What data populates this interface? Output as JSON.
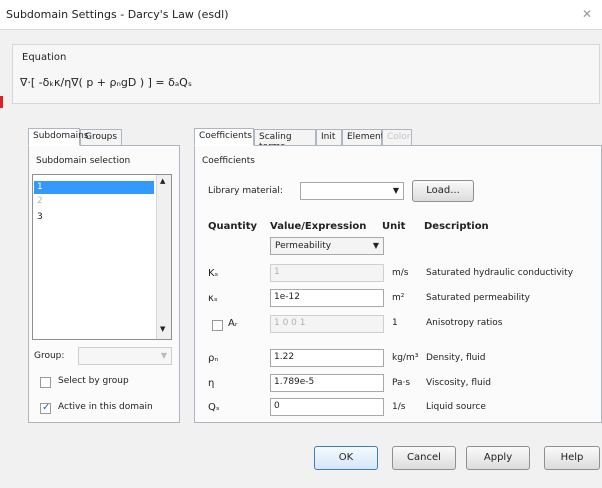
{
  "window": {
    "title": "Subdomain Settings - Darcy's Law (esdl)",
    "close_glyph": "✕"
  },
  "equation": {
    "label": "Equation",
    "formula": "∇·[ -δₖκ/η∇( p + ρₙgD ) ] = δₐQₛ"
  },
  "left_tabs": {
    "subdomains": "Subdomains",
    "groups": "Groups"
  },
  "subdomain_selection": {
    "label": "Subdomain selection",
    "items": [
      "1",
      "2",
      "3"
    ]
  },
  "group": {
    "label": "Group:",
    "value": ""
  },
  "checkboxes": {
    "select_by_group": "Select by group",
    "active_in_domain": "Active in this domain"
  },
  "right_tabs": {
    "coefficients": "Coefficients",
    "scaling_terms": "Scaling terms",
    "init": "Init",
    "element": "Element",
    "color": "Color"
  },
  "coefficients": {
    "group_label": "Coefficients",
    "library_material_label": "Library material:",
    "library_material_value": "",
    "load_button": "Load...",
    "headers": {
      "quantity": "Quantity",
      "value": "Value/Expression",
      "unit": "Unit",
      "description": "Description"
    },
    "model_select": "Permeability",
    "rows": [
      {
        "quantity": "Kₛ",
        "value": "1",
        "unit": "m/s",
        "description": "Saturated hydraulic conductivity"
      },
      {
        "quantity": "κₛ",
        "value": "1e-12",
        "unit": "m²",
        "description": "Saturated permeability"
      },
      {
        "quantity": "Aᵣ",
        "value": "1 0 0 1",
        "unit": "1",
        "description": "Anisotropy ratios"
      },
      {
        "quantity": "ρₙ",
        "value": "1.22",
        "unit": "kg/m³",
        "description": "Density, fluid"
      },
      {
        "quantity": "η",
        "value": "1.789e-5",
        "unit": "Pa·s",
        "description": "Viscosity, fluid"
      },
      {
        "quantity": "Qₛ",
        "value": "0",
        "unit": "1/s",
        "description": "Liquid source"
      }
    ]
  },
  "buttons": {
    "ok": "OK",
    "cancel": "Cancel",
    "apply": "Apply",
    "help": "Help"
  }
}
